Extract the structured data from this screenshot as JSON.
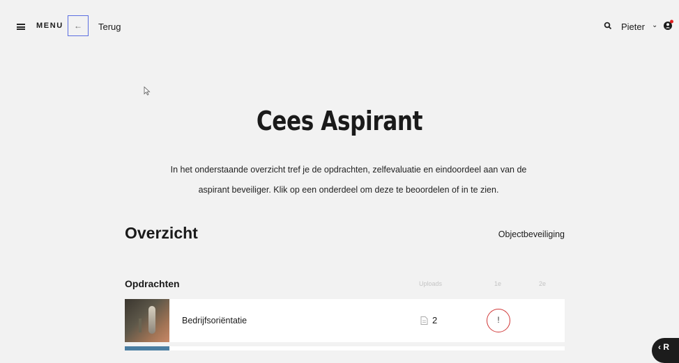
{
  "header": {
    "menu_label": "MENU",
    "back_label": "Terug",
    "user_name": "Pieter",
    "notification_color": "#e02020"
  },
  "page": {
    "title": "Cees Aspirant",
    "intro_line1": "In het onderstaande overzicht tref je de opdrachten, zelfevaluatie en eindoordeel aan van de",
    "intro_line2": "aspirant beveiliger. Klik op een onderdeel om deze te beoordelen of in te zien."
  },
  "overview": {
    "title": "Overzicht",
    "subtitle": "Objectbeveiliging"
  },
  "assignments": {
    "title": "Opdrachten",
    "columns": [
      "Uploads",
      "1e",
      "2e"
    ],
    "rows": [
      {
        "label": "Bedrijfsoriëntatie",
        "uploads": "2",
        "first_status": "!",
        "second_status": ""
      }
    ]
  },
  "floating_button": {
    "label": "‹ R"
  },
  "colors": {
    "accent": "#5b6ee1",
    "alert": "#d03838",
    "background": "#f2f2f2"
  },
  "icons": [
    "hamburger-icon",
    "arrow-left-icon",
    "search-icon",
    "chevron-down-icon",
    "user-icon",
    "document-icon",
    "exclamation-icon",
    "cursor-icon"
  ]
}
